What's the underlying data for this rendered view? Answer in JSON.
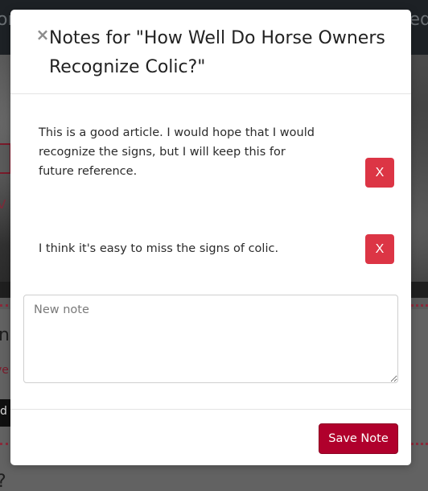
{
  "background": {
    "topbar_left_text": "or",
    "topbar_right_text": "ed",
    "content_letter_1": "n",
    "content_red_text": "ve",
    "content_black_button": "d",
    "content_letter_2": "?"
  },
  "modal": {
    "close_label": "×",
    "title": "Notes for \"How Well Do Horse Owners Recognize Colic?\"",
    "notes": [
      {
        "text": "This is a good article. I would hope that I would recognize the signs, but I will keep this for future reference.",
        "delete_label": "X"
      },
      {
        "text": "I think it's easy to miss the signs of colic.",
        "delete_label": "X"
      }
    ],
    "new_note": {
      "value": "",
      "placeholder": "New note"
    },
    "save_label": "Save Note"
  },
  "colors": {
    "delete_button": "#dc3545",
    "save_button": "#b0002c"
  }
}
